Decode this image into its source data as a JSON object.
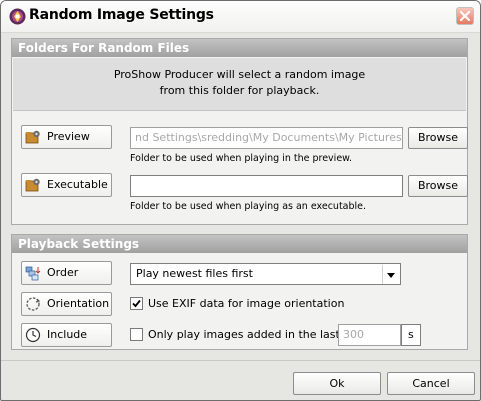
{
  "window": {
    "title": "Random Image Settings",
    "icons": {
      "app": "app-logo-icon",
      "close": "close-icon"
    }
  },
  "folders": {
    "header": "Folders For Random Files",
    "info_line1": "ProShow Producer will select a random image",
    "info_line2": "from this folder for playback.",
    "preview": {
      "label": "Preview",
      "icon": "folder-gear-icon",
      "path": "nd Settings\\sredding\\My Documents\\My Pictures",
      "browse": "Browse",
      "hint": "Folder to be used when playing in the preview."
    },
    "executable": {
      "label": "Executable",
      "icon": "folder-gear-icon",
      "path": "",
      "browse": "Browse",
      "hint": "Folder to be used when playing as an executable."
    }
  },
  "playback": {
    "header": "Playback Settings",
    "order": {
      "label": "Order",
      "icon": "sort-order-icon",
      "selected": "Play newest files first"
    },
    "orientation": {
      "label": "Orientation",
      "icon": "rotate-icon",
      "checkbox_checked": true,
      "checkbox_label": "Use EXIF data for image orientation"
    },
    "include": {
      "label": "Include",
      "icon": "clock-icon",
      "checkbox_checked": false,
      "checkbox_label": "Only play images added in the last",
      "value": "300",
      "unit": "s"
    }
  },
  "footer": {
    "ok": "Ok",
    "cancel": "Cancel"
  }
}
